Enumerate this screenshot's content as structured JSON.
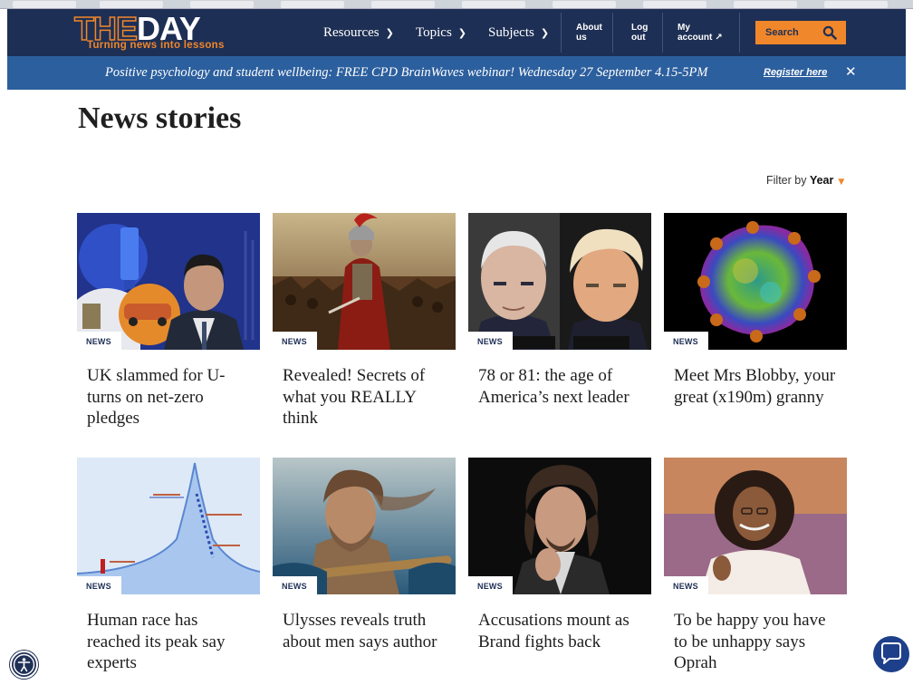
{
  "header": {
    "logo_word_the": "THE",
    "logo_word_day": "DAY",
    "logo_tagline": "Turning news into lessons",
    "nav": [
      {
        "label": "Resources"
      },
      {
        "label": "Topics"
      },
      {
        "label": "Subjects"
      }
    ],
    "about": {
      "line1": "About",
      "line2": "us"
    },
    "logout": {
      "line1": "Log",
      "line2": "out"
    },
    "account": {
      "line1": "My",
      "line2": "account"
    },
    "search_label": "Search"
  },
  "banner": {
    "message": "Positive psychology and student wellbeing: FREE CPD BrainWaves webinar! Wednesday 27 September 4.15-5PM",
    "register_label": "Register here",
    "close_label": "✕"
  },
  "page": {
    "title": "News stories",
    "filter_prefix": "Filter by",
    "filter_value": "Year"
  },
  "cards": [
    {
      "badge": "NEWS",
      "headline": "UK slammed for U-turns on net-zero pledges"
    },
    {
      "badge": "NEWS",
      "headline": "Revealed! Secrets of what you REALLY think"
    },
    {
      "badge": "NEWS",
      "headline": "78 or 81: the age of America’s next leader"
    },
    {
      "badge": "NEWS",
      "headline": "Meet Mrs Blobby, your great (x190m) granny"
    },
    {
      "badge": "NEWS",
      "headline": "Human race has reached its peak say experts"
    },
    {
      "badge": "NEWS",
      "headline": "Ulysses reveals truth about men says author"
    },
    {
      "badge": "NEWS",
      "headline": "Accusations mount as Brand fights back"
    },
    {
      "badge": "NEWS",
      "headline": "To be happy you have to be unhappy says Oprah"
    }
  ],
  "colors": {
    "navy": "#1e2f55",
    "banner_blue": "#2c5f9e",
    "orange": "#f0872a"
  }
}
